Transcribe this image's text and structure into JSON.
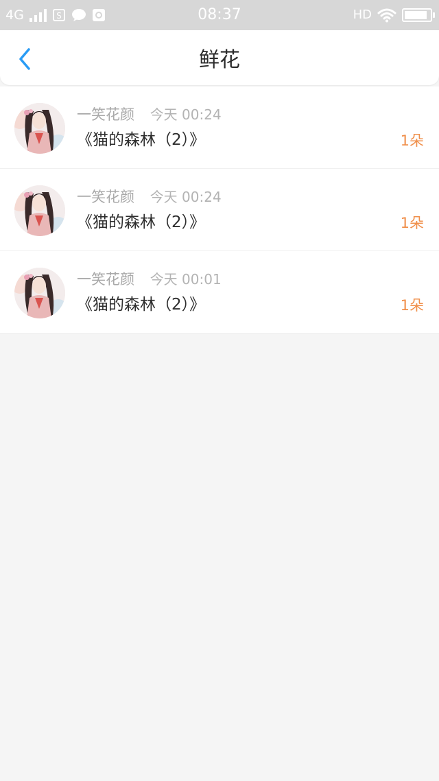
{
  "status_bar": {
    "network": "4G",
    "time": "08:37",
    "hd": "HD",
    "battery_level": 0.9,
    "icons": [
      "signal-icon",
      "sim-icon",
      "chat-bubble-icon",
      "camera-icon",
      "wifi-icon",
      "battery-icon"
    ]
  },
  "header": {
    "title": "鲜花",
    "back_icon": "chevron-left-icon",
    "accent_color": "#2a9cf5"
  },
  "items": [
    {
      "user": "一笑花颜",
      "time": "今天 00:24",
      "title": "《猫的森林（2）》",
      "count": "1朵"
    },
    {
      "user": "一笑花颜",
      "time": "今天 00:24",
      "title": "《猫的森林（2）》",
      "count": "1朵"
    },
    {
      "user": "一笑花颜",
      "time": "今天 00:01",
      "title": "《猫的森林（2）》",
      "count": "1朵"
    }
  ],
  "colors": {
    "count": "#f08f4a",
    "meta": "#a9a9a9",
    "title": "#2e2e2e",
    "background": "#f5f5f5"
  }
}
